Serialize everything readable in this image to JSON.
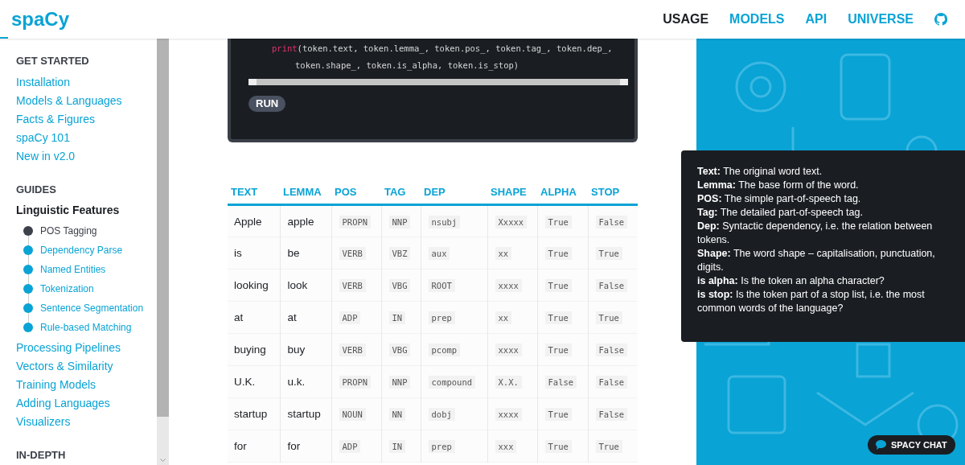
{
  "header": {
    "logo": "spaCy",
    "nav": [
      {
        "label": "USAGE",
        "selected": true
      },
      {
        "label": "MODELS",
        "selected": false
      },
      {
        "label": "API",
        "selected": false
      },
      {
        "label": "UNIVERSE",
        "selected": false
      }
    ]
  },
  "sidebar": {
    "sections": [
      {
        "title": "GET STARTED",
        "items": [
          {
            "label": "Installation",
            "selected": false
          },
          {
            "label": "Models & Languages",
            "selected": false
          },
          {
            "label": "Facts & Figures",
            "selected": false
          },
          {
            "label": "spaCy 101",
            "selected": false
          },
          {
            "label": "New in v2.0",
            "selected": false
          }
        ]
      },
      {
        "title": "GUIDES",
        "items": [
          {
            "label": "Linguistic Features",
            "selected": true,
            "children": [
              {
                "label": "POS Tagging",
                "selected": true
              },
              {
                "label": "Dependency Parse",
                "selected": false
              },
              {
                "label": "Named Entities",
                "selected": false
              },
              {
                "label": "Tokenization",
                "selected": false
              },
              {
                "label": "Sentence Segmentation",
                "selected": false
              },
              {
                "label": "Rule-based Matching",
                "selected": false
              }
            ]
          },
          {
            "label": "Processing Pipelines",
            "selected": false
          },
          {
            "label": "Vectors & Similarity",
            "selected": false
          },
          {
            "label": "Training Models",
            "selected": false
          },
          {
            "label": "Adding Languages",
            "selected": false
          },
          {
            "label": "Visualizers",
            "selected": false
          }
        ]
      },
      {
        "title": "IN-DEPTH"
      }
    ]
  },
  "code": {
    "lines": [
      {
        "keyword": "print",
        "rest": "(token.text, token.lemma_, token.pos_, token.tag_, token.dep_,"
      },
      {
        "rest": "token.shape_, token.is_alpha, token.is_stop)"
      }
    ],
    "run_button": "RUN"
  },
  "table": {
    "columns": [
      "TEXT",
      "LEMMA",
      "POS",
      "TAG",
      "DEP",
      "SHAPE",
      "ALPHA",
      "STOP"
    ],
    "rows": [
      [
        "Apple",
        "apple",
        "PROPN",
        "NNP",
        "nsubj",
        "Xxxxx",
        "True",
        "False"
      ],
      [
        "is",
        "be",
        "VERB",
        "VBZ",
        "aux",
        "xx",
        "True",
        "True"
      ],
      [
        "looking",
        "look",
        "VERB",
        "VBG",
        "ROOT",
        "xxxx",
        "True",
        "False"
      ],
      [
        "at",
        "at",
        "ADP",
        "IN",
        "prep",
        "xx",
        "True",
        "True"
      ],
      [
        "buying",
        "buy",
        "VERB",
        "VBG",
        "pcomp",
        "xxxx",
        "True",
        "False"
      ],
      [
        "U.K.",
        "u.k.",
        "PROPN",
        "NNP",
        "compound",
        "X.X.",
        "False",
        "False"
      ],
      [
        "startup",
        "startup",
        "NOUN",
        "NN",
        "dobj",
        "xxxx",
        "True",
        "False"
      ],
      [
        "for",
        "for",
        "ADP",
        "IN",
        "prep",
        "xxx",
        "True",
        "True"
      ]
    ]
  },
  "tooltip": {
    "lines": [
      "**Text:** The original word text.",
      "**Lemma:** The base form of the word.",
      "**POS:** The simple part-of-speech tag.",
      "**Tag:** The detailed part-of-speech tag.",
      "**Dep:** Syntactic dependency, i.e. the relation between tokens.",
      "**Shape:** The word shape – capitalisation, punctuation, digits.",
      "**is alpha:** Is the token an alpha character?",
      "**is stop:** Is the token part of a stop list, i.e. the most common words of the language?"
    ]
  },
  "chat_button": "SPACY CHAT"
}
